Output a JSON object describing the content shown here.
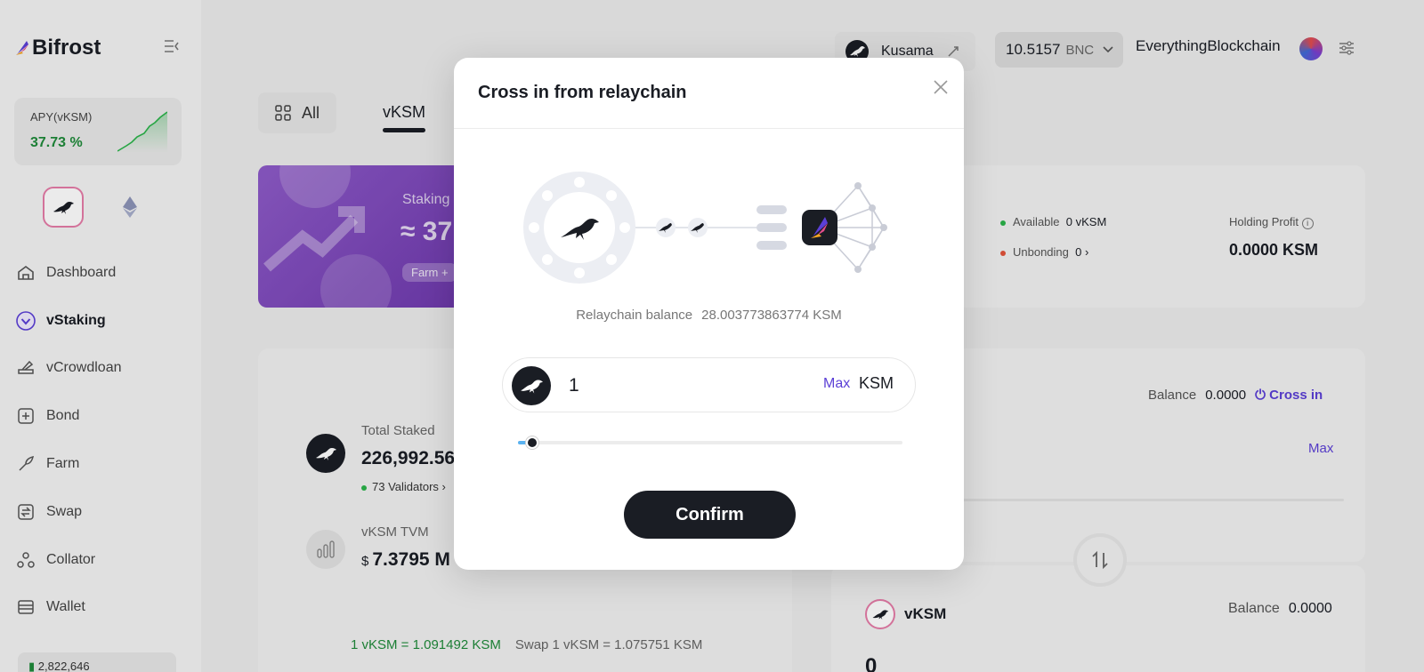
{
  "sidebar": {
    "logo": "Bifrost",
    "apy_label": "APY(vKSM)",
    "apy_value": "37.73 %",
    "items": [
      {
        "label": "Dashboard",
        "icon": "dashboard-icon"
      },
      {
        "label": "vStaking",
        "icon": "vstaking-icon"
      },
      {
        "label": "vCrowdloan",
        "icon": "vcrowdloan-icon"
      },
      {
        "label": "Bond",
        "icon": "bond-icon"
      },
      {
        "label": "Farm",
        "icon": "farm-icon"
      },
      {
        "label": "Swap",
        "icon": "swap-icon"
      },
      {
        "label": "Collator",
        "icon": "collator-icon"
      },
      {
        "label": "Wallet",
        "icon": "wallet-icon"
      }
    ],
    "active_item": "vStaking",
    "footer_value": "2,822,646"
  },
  "header": {
    "chain": "Kusama",
    "bnc_amount": "10.5157",
    "bnc_unit": "BNC",
    "account": "EverythingBlockchain"
  },
  "main": {
    "tabs": [
      {
        "label": "All"
      },
      {
        "label": "vKSM"
      }
    ],
    "banner": {
      "line1": "Staking",
      "line2": "≈ 37",
      "pill": "Farm +"
    },
    "stats": {
      "available_label": "Available",
      "available_value": "0 vKSM",
      "unbonding_label": "Unbonding",
      "unbonding_value": "0 ›",
      "holding_label": "Holding Profit",
      "holding_value": "0.0000 KSM"
    },
    "total_staked_label": "Total Staked",
    "total_staked_value": "226,992.56",
    "validators": "73 Validators ›",
    "tvm_label": "vKSM TVM",
    "tvm_prefix": "$",
    "tvm_value": "7.3795 M",
    "rate_green": "1 vKSM = 1.091492 KSM",
    "rate_swap": "Swap 1 vKSM = 1.075751 KSM",
    "form": {
      "balance_label": "Balance",
      "balance_value": "0.0000",
      "cross_in": "Cross in",
      "max": "Max"
    },
    "vksm_card": {
      "token": "vKSM",
      "balance_label": "Balance",
      "balance_value": "0.0000",
      "amount": "0"
    }
  },
  "modal": {
    "title": "Cross in from relaychain",
    "relay_label": "Relaychain balance",
    "relay_value": "28.003773863774 KSM",
    "input_value": "1",
    "max_label": "Max",
    "unit": "KSM",
    "slider_fraction": 0.036,
    "confirm_label": "Confirm"
  },
  "colors": {
    "accent": "#5b3fd6",
    "positive": "#1f8a3a",
    "dark": "#1a1d24",
    "slider": "#5ab2f0"
  }
}
